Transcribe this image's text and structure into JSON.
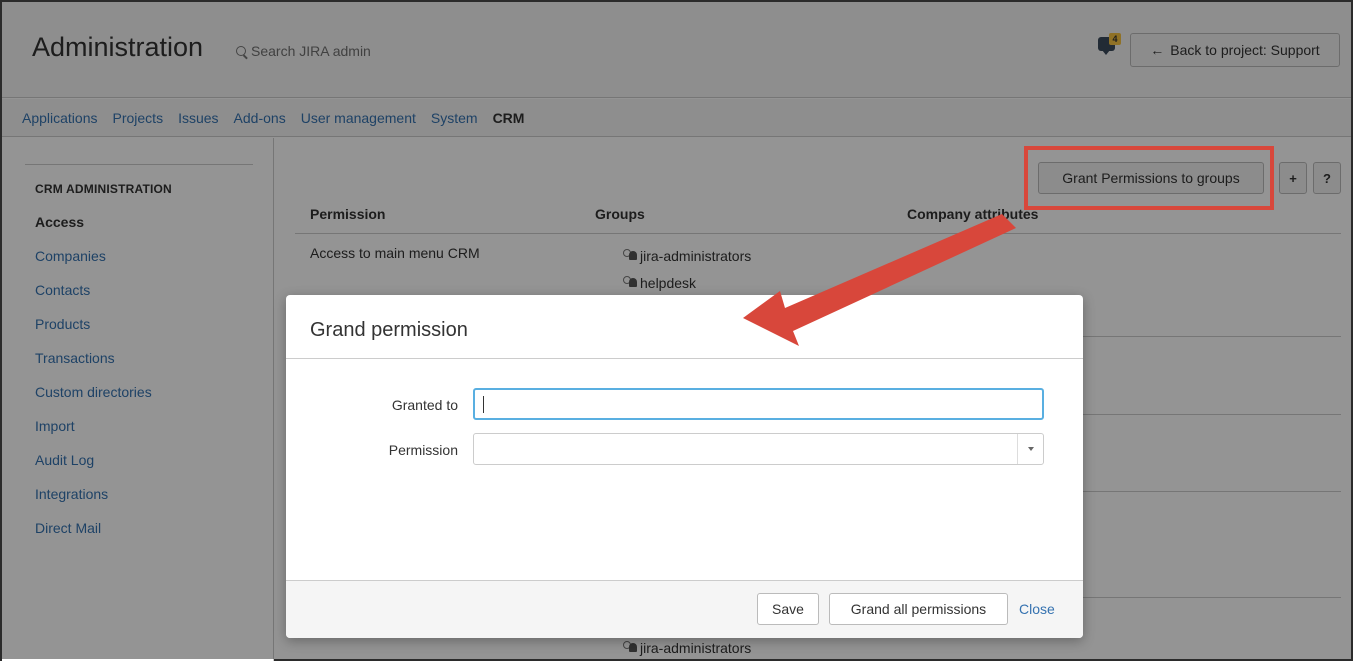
{
  "header": {
    "title": "Administration",
    "search_placeholder": "Search JIRA admin",
    "notification_count": "4",
    "back_button": "Back to project: Support"
  },
  "nav": {
    "items": [
      "Applications",
      "Projects",
      "Issues",
      "Add-ons",
      "User management",
      "System",
      "CRM"
    ],
    "active": "CRM"
  },
  "sidebar": {
    "heading": "CRM ADMINISTRATION",
    "items": [
      "Access",
      "Companies",
      "Contacts",
      "Products",
      "Transactions",
      "Custom directories",
      "Import",
      "Audit Log",
      "Integrations",
      "Direct Mail"
    ],
    "active": "Access"
  },
  "main": {
    "grant_button": "Grant Permissions to groups",
    "add_icon_label": "+",
    "help_label": "?",
    "columns": [
      "Permission",
      "Groups",
      "Company attributes"
    ],
    "rows": [
      {
        "permission": "Access to main menu CRM",
        "groups": [
          "jira-administrators",
          "helpdesk"
        ]
      }
    ],
    "bottom_group": "jira-administrators"
  },
  "dialog": {
    "title": "Grand permission",
    "granted_to_label": "Granted to",
    "granted_to_value": "",
    "permission_label": "Permission",
    "permission_value": "",
    "save": "Save",
    "grand_all": "Grand all permissions",
    "close": "Close"
  },
  "colors": {
    "link": "#3572b0",
    "highlight": "#d8473b",
    "focus": "#59afe1"
  }
}
